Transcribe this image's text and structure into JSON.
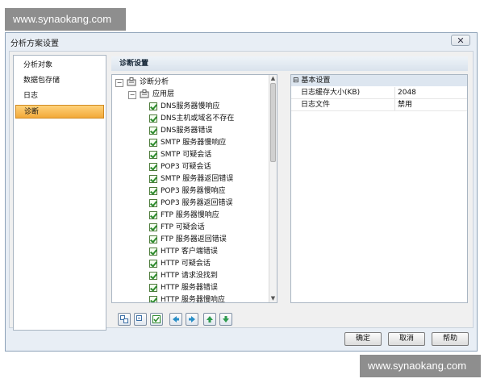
{
  "watermark": {
    "text": "www.synaokang.com"
  },
  "window": {
    "title": "分析方案设置",
    "close_glyph": "✕"
  },
  "nav": {
    "items": [
      {
        "label": "分析对象"
      },
      {
        "label": "数据包存储"
      },
      {
        "label": "日志"
      },
      {
        "label": "诊断",
        "active": true
      }
    ]
  },
  "section": {
    "title": "诊断设置"
  },
  "tree": {
    "root": {
      "label": "诊断分析",
      "expander": "−"
    },
    "group": {
      "label": "应用层",
      "expander": "−"
    },
    "items": [
      {
        "label": "DNS服务器慢响应"
      },
      {
        "label": "DNS主机或域名不存在"
      },
      {
        "label": "DNS服务器错误"
      },
      {
        "label": "SMTP 服务器慢响应"
      },
      {
        "label": "SMTP 可疑会话"
      },
      {
        "label": "POP3 可疑会话"
      },
      {
        "label": "SMTP 服务器返回错误"
      },
      {
        "label": "POP3 服务器慢响应"
      },
      {
        "label": "POP3 服务器返回错误"
      },
      {
        "label": "FTP 服务器慢响应"
      },
      {
        "label": "FTP 可疑会话"
      },
      {
        "label": "FTP 服务器返回错误"
      },
      {
        "label": "HTTP 客户端错误"
      },
      {
        "label": "HTTP 可疑会话"
      },
      {
        "label": "HTTP 请求没找到"
      },
      {
        "label": "HTTP 服务器错误"
      },
      {
        "label": "HTTP 服务器慢响应"
      }
    ]
  },
  "properties": {
    "category": {
      "label": "基本设置",
      "expander": "⊟"
    },
    "rows": [
      {
        "key": "日志缓存大小(KB)",
        "value": "2048"
      },
      {
        "key": "日志文件",
        "value": "禁用"
      }
    ]
  },
  "toolbar": {
    "buttons": [
      {
        "icon": "expand-all-icon"
      },
      {
        "icon": "collapse-all-icon"
      },
      {
        "icon": "check-all-icon"
      },
      {
        "icon": "move-left-icon"
      },
      {
        "icon": "move-right-icon"
      },
      {
        "icon": "move-up-icon"
      },
      {
        "icon": "move-down-icon"
      }
    ]
  },
  "buttons": {
    "ok": "确定",
    "cancel": "取消",
    "help": "帮助"
  },
  "colors": {
    "accent": "#f2a93a",
    "check": "#2e8b2e",
    "border": "#a9b5c2"
  }
}
